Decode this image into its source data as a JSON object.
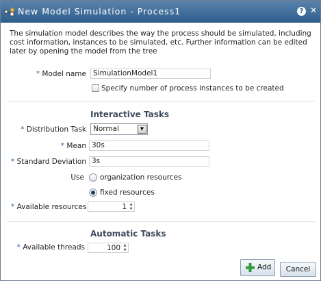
{
  "window": {
    "title": "New Model Simulation - Process1",
    "help_label": "?",
    "close_label": "✕"
  },
  "description": "The simulation model describes the way the process should be simulated, including cost information, instances to be simulated, etc. Further information can be edited later by opening the model from the tree",
  "required_marker": "*",
  "model": {
    "name_label": "Model name",
    "name_value": "SimulationModel1",
    "instances_checkbox_label": "Specify number of process instances to be created",
    "instances_checked": false
  },
  "interactive": {
    "section_title": "Interactive Tasks",
    "distribution_label": "Distribution Task",
    "distribution_value": "Normal",
    "mean_label": "Mean",
    "mean_value": "30s",
    "std_label": "Standard Deviation",
    "std_value": "3s",
    "use_label": "Use",
    "use_options": [
      {
        "label": "organization resources",
        "selected": false
      },
      {
        "label": "fixed resources",
        "selected": true
      }
    ],
    "available_resources_label": "Available resources",
    "available_resources_value": "1"
  },
  "automatic": {
    "section_title": "Automatic Tasks",
    "available_threads_label": "Available threads",
    "available_threads_value": "100"
  },
  "buttons": {
    "add_label": "Add",
    "cancel_label": "Cancel"
  },
  "colors": {
    "titlebar": "#3a6897",
    "required_marker": "#2d5fa0",
    "add_icon": "#2e9a3b"
  }
}
